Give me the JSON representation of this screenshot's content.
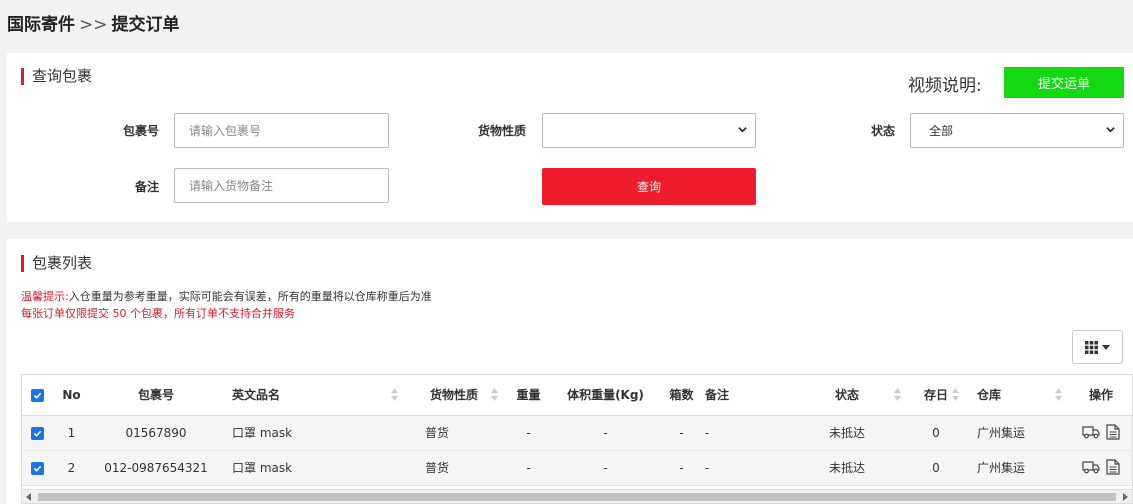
{
  "breadcrumb": {
    "home": "国际寄件",
    "sep": ">>",
    "current": "提交订单"
  },
  "query": {
    "title": "查询包裹",
    "video_label": "视频说明:",
    "submit_ship_label": "提交运单",
    "package_no_label": "包裹号",
    "package_no_placeholder": "请输入包裹号",
    "cargo_nature_label": "货物性质",
    "cargo_nature_value": "",
    "status_label": "状态",
    "status_value": "全部",
    "remark_label": "备注",
    "remark_placeholder": "请输入货物备注",
    "query_button": "查询"
  },
  "list": {
    "title": "包裹列表",
    "tip_prefix": "温馨提示:",
    "tip_text": "入仓重量为参考重量，实际可能会有误差，所有的重量将以仓库称重后为准",
    "tip2": "每张订单仅限提交 50 个包裹，所有订单不支持合并服务",
    "columns": {
      "no": "No",
      "package_no": "包裹号",
      "en_name": "英文品名",
      "cargo_nature": "货物性质",
      "weight": "重量",
      "vol_weight": "体积重量(Kg)",
      "boxes": "箱数",
      "remark": "备注",
      "status": "状态",
      "stock_days": "存日",
      "warehouse": "仓库",
      "actions": "操作"
    },
    "rows": [
      {
        "no": "1",
        "package_no": "01567890",
        "en_name": "口罩 mask",
        "cargo_nature": "普货",
        "weight": "-",
        "vol_weight": "-",
        "boxes": "-",
        "remark": "-",
        "status": "未抵达",
        "stock_days": "0",
        "warehouse": "广州集运"
      },
      {
        "no": "2",
        "package_no": "012-0987654321",
        "en_name": "口罩 mask",
        "cargo_nature": "普货",
        "weight": "-",
        "vol_weight": "-",
        "boxes": "-",
        "remark": "-",
        "status": "未抵达",
        "stock_days": "0",
        "warehouse": "广州集运"
      }
    ]
  },
  "colors": {
    "accent_red": "#ef1c2d",
    "submit_green": "#12d912",
    "checkbox_blue": "#1a73e8"
  },
  "icons": [
    "chevron-down-icon",
    "grid-columns-icon",
    "sort-icon",
    "checkbox-checked-icon",
    "truck-icon",
    "document-icon"
  ]
}
